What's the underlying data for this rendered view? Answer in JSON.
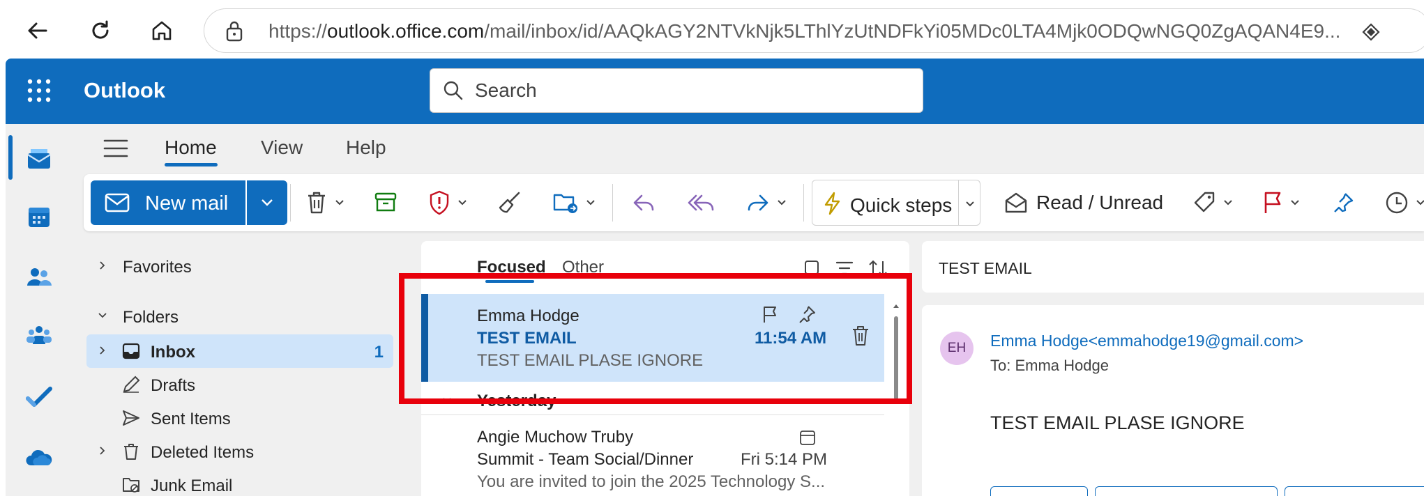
{
  "browser": {
    "url_prefix": "https://",
    "url_domain": "outlook.office.com",
    "url_path": "/mail/inbox/id/AAQkAGY2NTVkNjk5LThlYzUtNDFkYi05MDc0LTA4Mjk0ODQwNGQ0ZgAQAN4E9..."
  },
  "header": {
    "app_name": "Outlook",
    "search_placeholder": "Search"
  },
  "tabs": {
    "home": "Home",
    "view": "View",
    "help": "Help"
  },
  "ribbon": {
    "new_mail": "New mail",
    "quick_steps": "Quick steps",
    "read_unread": "Read / Unread"
  },
  "folders": {
    "favorites": "Favorites",
    "folders": "Folders",
    "inbox": "Inbox",
    "inbox_count": "1",
    "drafts": "Drafts",
    "sent": "Sent Items",
    "deleted": "Deleted Items",
    "junk": "Junk Email"
  },
  "list": {
    "focused": "Focused",
    "other": "Other",
    "selected": {
      "sender": "Emma Hodge",
      "subject": "TEST EMAIL",
      "time": "11:54 AM",
      "preview": "TEST EMAIL PLASE IGNORE"
    },
    "group": "Yesterday",
    "second": {
      "sender": "Angie Muchow Truby",
      "subject": "Summit - Team Social/Dinner",
      "time": "Fri 5:14 PM",
      "preview": "You are invited to join the 2025 Technology S..."
    }
  },
  "reading": {
    "subject": "TEST EMAIL",
    "avatar": "EH",
    "from": "Emma Hodge<emmahodge19@gmail.com>",
    "to_label": "To:",
    "to_name": "Emma Hodge",
    "body": "TEST EMAIL PLASE IGNORE"
  },
  "colors": {
    "brand": "#0f6cbd",
    "highlight": "#e8000b",
    "selected_bg": "#cfe4fa"
  }
}
